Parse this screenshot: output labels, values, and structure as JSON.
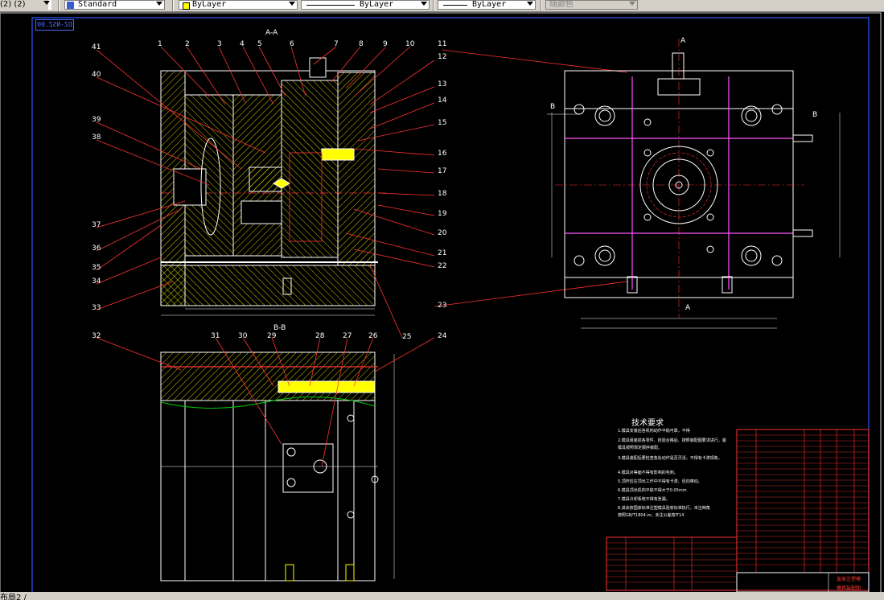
{
  "toolbar": {
    "left_text": "(2) (2)",
    "style_combo": "Standard",
    "layer_combo": "ByLayer",
    "linetype_combo": "ByLayer",
    "lineweight_combo": "ByLayer",
    "color_combo": "随颜色"
  },
  "drawing": {
    "stamp": "DZ-NSZ.00",
    "section_aa": "A-A",
    "section_bb": "B-B",
    "view_a_top": "A",
    "view_a_bottom": "A",
    "view_b_left": "B",
    "view_b_right": "B",
    "part_numbers_top": [
      "1",
      "2",
      "3",
      "4",
      "5",
      "6",
      "7",
      "8",
      "9",
      "10",
      "11"
    ],
    "part_numbers_right": [
      "12",
      "13",
      "14",
      "15",
      "16",
      "17",
      "18",
      "19",
      "20",
      "21",
      "22"
    ],
    "part_numbers_left": [
      "41",
      "40",
      "39",
      "38",
      "37",
      "36",
      "35",
      "34",
      "33"
    ],
    "part_numbers_bb": [
      "32",
      "31",
      "30",
      "29",
      "28",
      "27",
      "26",
      "24"
    ],
    "label_23": "23",
    "label_25": "25",
    "tech_title": "技术要求",
    "tech_lines": [
      "1.模具安装后各机构动作平稳可靠，不得",
      "2.模具组装前各零件、检验合格后、按照装配图要求进行，装",
      "  模具按照规定顺序装配。",
      "3.模具装配后要检查各处动作是否灵活，不得有卡滞现象。",
      "4.模具对等面不得有影响的毛刺。",
      "5.顶杆应在顶出工作中不得有卡滞、径向窜动。",
      "6.模具顶出机构平稳不得大于0.05mm",
      "7.模具冷却系统不得有泄漏。",
      "8.其余按国家标准注塑模具验收标准执行，未注倒角",
      "  按照GB/T1804-m，未注公差按IT14"
    ],
    "title_block": "盖类注塑模",
    "title_block_sub": "模具装配图"
  },
  "status_bar": {
    "text": "布局2 /"
  }
}
